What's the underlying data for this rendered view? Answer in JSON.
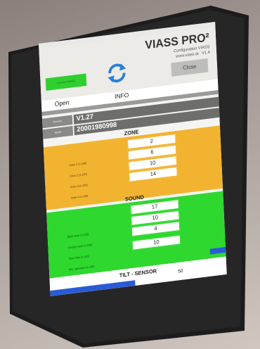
{
  "app": {
    "title": "VIASS PRO²",
    "configuration_line": "Configuration VIASS",
    "website_line": "www.viass.at",
    "version_short": "V1.4",
    "close_label": "Close",
    "connect_button_label": "Connect VIASS"
  },
  "tabs": [
    {
      "label": "Open"
    },
    {
      "label": "INFO"
    }
  ],
  "info": {
    "version_label": "Version",
    "version_value": "V1.27",
    "serial_label": "Serial",
    "serial_value": "20001980998"
  },
  "zone": {
    "title": "ZONE",
    "rows": [
      {
        "label": "Zone 1 (1-100)",
        "value": "2"
      },
      {
        "label": "Zone 2 (1-100)",
        "value": "6"
      },
      {
        "label": "Zone 3 (1-100)",
        "value": "10"
      },
      {
        "label": "Zone 4 (1-100)",
        "value": "14"
      }
    ]
  },
  "sound": {
    "title": "SOUND",
    "rows": [
      {
        "label": "Basic tone (1-100)",
        "value": "17"
      },
      {
        "label": "Counter tone (1-100)",
        "value": "10"
      },
      {
        "label": "Tone Vibe (1-100)",
        "value": "4"
      },
      {
        "label": "Min. operation (1-100)",
        "value": "10"
      }
    ]
  },
  "tilt": {
    "title": "TILT - SENSOR",
    "value": "50"
  },
  "colors": {
    "zone_bg": "#f2b430",
    "sound_bg": "#2ed82e",
    "accent_blue": "#2a5bd6",
    "connect_green": "#2fcf2f"
  },
  "navbar": {
    "icons": [
      "back-icon",
      "home-icon",
      "recents-icon"
    ]
  }
}
